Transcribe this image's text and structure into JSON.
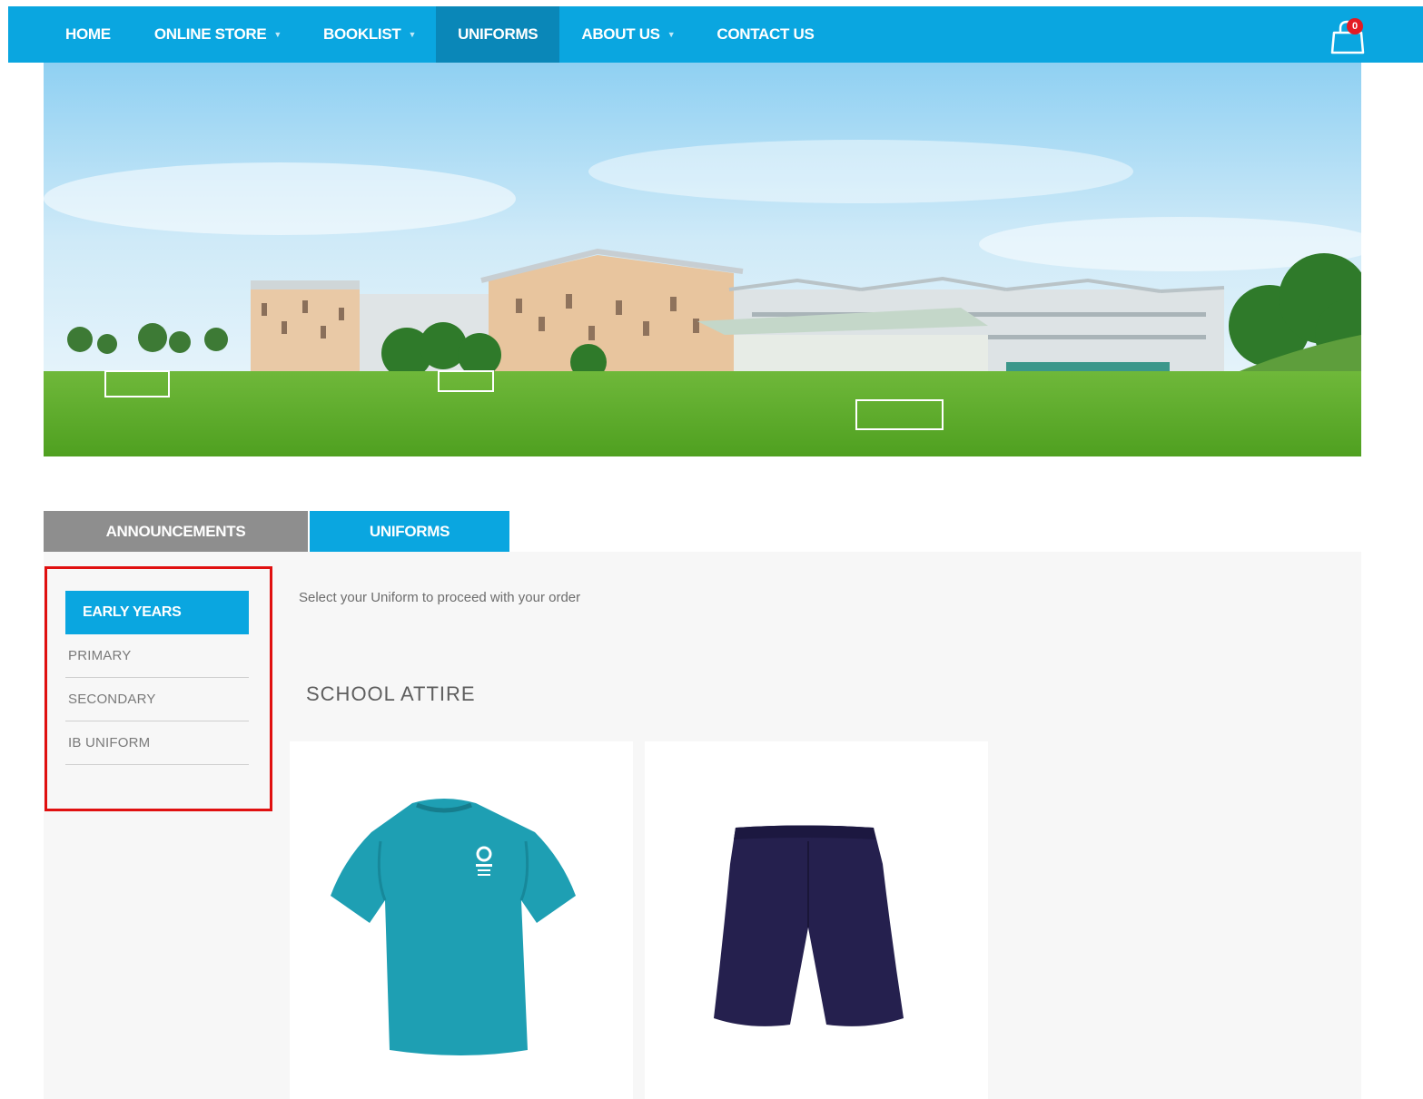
{
  "nav": {
    "items": [
      {
        "label": "HOME",
        "has_dropdown": false
      },
      {
        "label": "ONLINE STORE",
        "has_dropdown": true
      },
      {
        "label": "BOOKLIST",
        "has_dropdown": true
      },
      {
        "label": "UNIFORMS",
        "has_dropdown": false,
        "active": true
      },
      {
        "label": "ABOUT US",
        "has_dropdown": true
      },
      {
        "label": "CONTACT US",
        "has_dropdown": false
      }
    ],
    "cart_count": "0",
    "cart_icon": "shopping-bag-icon"
  },
  "tabs": {
    "announcements": "ANNOUNCEMENTS",
    "uniforms": "UNIFORMS"
  },
  "side_menu": {
    "items": [
      {
        "label": "EARLY YEARS",
        "active": true
      },
      {
        "label": "PRIMARY"
      },
      {
        "label": "SECONDARY"
      },
      {
        "label": "IB UNIFORM"
      }
    ]
  },
  "content": {
    "instruction": "Select your Uniform to proceed with your order",
    "section_title": "SCHOOL ATTIRE"
  },
  "products": [
    {
      "image": "teal-tshirt-image",
      "color": "#1e9fb3"
    },
    {
      "image": "navy-shorts-image",
      "color": "#25204e"
    }
  ],
  "colors": {
    "primary": "#0aa6e0",
    "nav_active": "#0a87b8",
    "tab_inactive": "#8e8e8e",
    "highlight": "#e01010",
    "badge": "#e31b23"
  }
}
